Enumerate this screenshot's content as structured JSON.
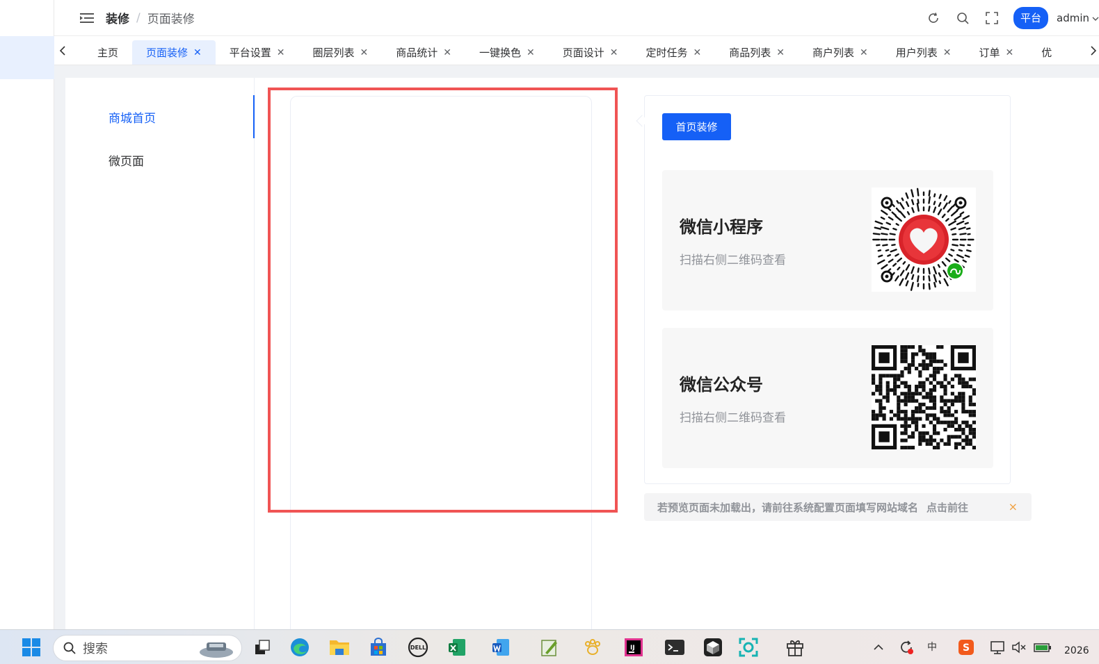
{
  "header": {
    "breadcrumb_root": "装修",
    "breadcrumb_sep": "/",
    "breadcrumb_current": "页面装修",
    "platform_label": "平台",
    "user_name": "admin"
  },
  "tabs": [
    {
      "label": "主页",
      "closable": false,
      "active": false
    },
    {
      "label": "页面装修",
      "closable": true,
      "active": true
    },
    {
      "label": "平台设置",
      "closable": true,
      "active": false
    },
    {
      "label": "圈层列表",
      "closable": true,
      "active": false
    },
    {
      "label": "商品统计",
      "closable": true,
      "active": false
    },
    {
      "label": "一键换色",
      "closable": true,
      "active": false
    },
    {
      "label": "页面设计",
      "closable": true,
      "active": false
    },
    {
      "label": "定时任务",
      "closable": true,
      "active": false
    },
    {
      "label": "商品列表",
      "closable": true,
      "active": false
    },
    {
      "label": "商户列表",
      "closable": true,
      "active": false
    },
    {
      "label": "用户列表",
      "closable": true,
      "active": false
    },
    {
      "label": "订单",
      "closable": true,
      "active": false
    },
    {
      "label": "优",
      "closable": false,
      "active": false
    }
  ],
  "leftnav": {
    "items": [
      {
        "label": "商城首页",
        "active": true
      },
      {
        "label": "微页面",
        "active": false
      }
    ]
  },
  "panel": {
    "button_label": "首页装修",
    "cards": [
      {
        "title": "微信小程序",
        "subtitle": "扫描右侧二维码查看",
        "qr_type": "mini-program-code"
      },
      {
        "title": "微信公众号",
        "subtitle": "扫描右侧二维码查看",
        "qr_type": "qr-code"
      }
    ]
  },
  "alert": {
    "message": "若预览页面未加载出，请前往系统配置页面填写网站域名",
    "link": "点击前往",
    "close": "×"
  },
  "taskbar": {
    "search_placeholder": "搜索",
    "ime": "中",
    "clock": "2026"
  },
  "colors": {
    "primary": "#1560f6",
    "highlight_border": "#f05454",
    "alert_close": "#f0a040"
  }
}
